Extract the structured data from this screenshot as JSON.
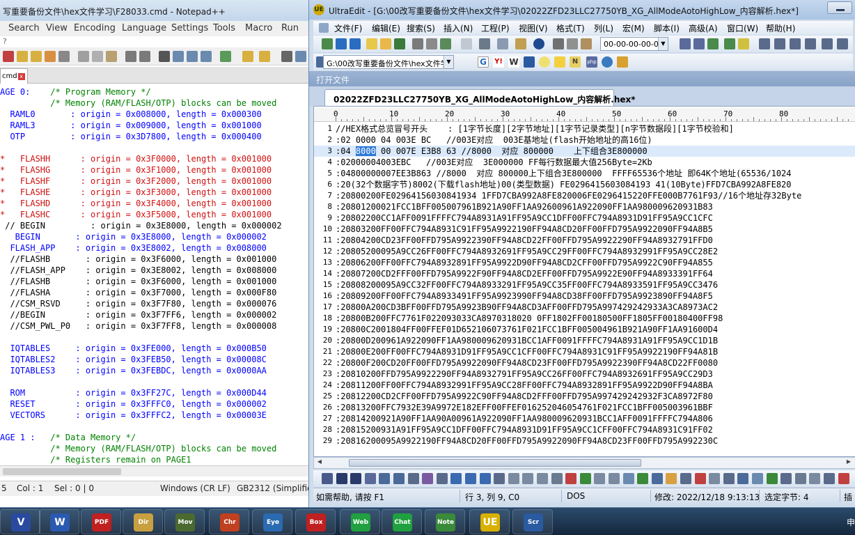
{
  "npp": {
    "title": "写重要备份文件\\hex文件学习\\F28033.cmd - Notepad++",
    "menu": [
      "Search",
      "View",
      "Encoding",
      "Language",
      "Settings",
      "Tools",
      "Macro",
      "Run"
    ],
    "menu_extra": "?",
    "tab_label": "cmd",
    "tab_close": "x",
    "code_lines": [
      {
        "a": "AGE 0:    ",
        "b": "/* Program Memory */",
        "cls": "c-kw"
      },
      {
        "a": "          ",
        "b": "/* Memory (RAM/FLASH/OTP) blocks can be moved",
        "cls": "c-kw"
      },
      {
        "a": "  RAML0       : origin = 0x008000, length = 0x000300",
        "b": "",
        "cls": ""
      },
      {
        "a": "  RAML3       : origin = 0x009000, length = 0x001000",
        "b": "",
        "cls": ""
      },
      {
        "a": "  OTP         : origin = 0x3D7800, length = 0x000400",
        "b": "",
        "cls": ""
      },
      {
        "a": "",
        "b": "",
        "cls": ""
      },
      {
        "a": "*   FLASHH      : origin = 0x3F0000, length = 0x001000",
        "b": "",
        "cls": ""
      },
      {
        "a": "*   FLASHG      : origin = 0x3F1000, length = 0x001000",
        "b": "",
        "cls": ""
      },
      {
        "a": "*   FLASHF      : origin = 0x3F2000, length = 0x001000",
        "b": "",
        "cls": ""
      },
      {
        "a": "*   FLASHE      : origin = 0x3F3000, length = 0x001000",
        "b": "",
        "cls": ""
      },
      {
        "a": "*   FLASHD      : origin = 0x3F4000, length = 0x001000",
        "b": "",
        "cls": ""
      },
      {
        "a": "*   FLASHC      : origin = 0x3F5000, length = 0x001000",
        "b": "",
        "cls": ""
      },
      {
        "a": " // BEGIN         : origin = 0x3E8000, length = 0x000002",
        "b": "",
        "cls": ""
      },
      {
        "a": "   BEGIN       : origin = 0x3E8000, length = 0x000002",
        "b": "",
        "cls": ""
      },
      {
        "a": "  FLASH_APP    : origin = 0x3E8002, length = 0x008000",
        "b": "",
        "cls": ""
      },
      {
        "a": "  //FLASHB       : origin = 0x3F6000, length = 0x001000",
        "b": "",
        "cls": ""
      },
      {
        "a": "  //FLASH_APP    : origin = 0x3E8002, length = 0x008000",
        "b": "",
        "cls": ""
      },
      {
        "a": "  //FLASHB       : origin = 0x3F6000, length = 0x001000",
        "b": "",
        "cls": ""
      },
      {
        "a": "  //FLASHA       : origin = 0x3F7000, length = 0x000F80",
        "b": "",
        "cls": ""
      },
      {
        "a": "  //CSM_RSVD     : origin = 0x3F7F80, length = 0x000076",
        "b": "",
        "cls": ""
      },
      {
        "a": "  //BEGIN        : origin = 0x3F7FF6, length = 0x000002",
        "b": "",
        "cls": ""
      },
      {
        "a": "  //CSM_PWL_P0   : origin = 0x3F7FF8, length = 0x000008",
        "b": "",
        "cls": ""
      },
      {
        "a": "",
        "b": "",
        "cls": ""
      },
      {
        "a": "  IQTABLES     : origin = 0x3FE000, length = 0x000B50",
        "b": "",
        "cls": ""
      },
      {
        "a": "  IQTABLES2    : origin = 0x3FEB50, length = 0x00008C",
        "b": "",
        "cls": ""
      },
      {
        "a": "  IQTABLES3    : origin = 0x3FEBDC, length = 0x0000AA",
        "b": "",
        "cls": ""
      },
      {
        "a": "",
        "b": "",
        "cls": ""
      },
      {
        "a": "  ROM          : origin = 0x3FF27C, length = 0x000D44",
        "b": "",
        "cls": ""
      },
      {
        "a": "  RESET        : origin = 0x3FFFC0, length = 0x000002",
        "b": "",
        "cls": ""
      },
      {
        "a": "  VECTORS      : origin = 0x3FFFC2, length = 0x00003E",
        "b": "",
        "cls": ""
      },
      {
        "a": "",
        "b": "",
        "cls": ""
      },
      {
        "a": "AGE 1 :   ",
        "b": "/* Data Memory */",
        "cls": "c-kw"
      },
      {
        "a": "          ",
        "b": "/* Memory (RAM/FLASH/OTP) blocks can be moved",
        "cls": "c-kw"
      },
      {
        "a": "          ",
        "b": "/* Registers remain on PAGE1",
        "cls": "c-kw"
      }
    ],
    "status": {
      "line": "5",
      "col": "Col : 1",
      "sel": "Sel : 0 | 0",
      "eol": "Windows (CR LF)",
      "enc": "GB2312 (Simplifie"
    }
  },
  "ue": {
    "title": "UltraEdit - [G:\\00改写重要备份文件\\hex文件学习\\02022ZFD23LLC27750YB_XG_AllModeAotoHighLow_内容解析.hex*]",
    "logo": "UE",
    "menu": [
      "文件(F)",
      "编辑(E)",
      "搜索(S)",
      "插入(N)",
      "工程(P)",
      "视图(V)",
      "格式(T)",
      "列(L)",
      "宏(M)",
      "脚本(I)",
      "高级(A)",
      "窗口(W)",
      "帮助(H)"
    ],
    "hex_combo": "00-00-00-00-0(",
    "path_combo": "G:\\00改写重要备份文件\\hex文件学",
    "open_files_label": "打开文件",
    "tab_name": "02022ZFD23LLC27750YB_XG_AllModeAotoHighLow_内容解析.hex*",
    "tab_close": "×",
    "ruler_labels": [
      "0",
      "10",
      "20",
      "30",
      "40",
      "50",
      "60",
      "70",
      "80"
    ],
    "lines": [
      {
        "n": "1",
        "t": "//HEX格式总览冒号开头    : [1字节长度][2字节地址][1字节记录类型][n字节数据段][1字节校验和]"
      },
      {
        "n": "2",
        "t": ":02 0000 04 003E BC   //003E对应  003E基地址(flash开始地址的高16位)"
      },
      {
        "n": "3",
        "pre": ":04 ",
        "hl": "8000",
        "post": " 00 007E E3B8 63 //8000  对应 800000    上下组合3E800000"
      },
      {
        "n": "4",
        "t": ":02000004003EBC   //003E对应  3E000000 FF每行数据最大值256Byte=2Kb"
      },
      {
        "n": "5",
        "t": ":04800000007EE3B863 //8000  对应 800000上下组合3E800000  FFFF65536个地址 即64K个地址(65536/1024"
      },
      {
        "n": "6",
        "t": ":20(32个数据字节)8002(下载flash地址)00(类型数据) FE0296415603084193 41(10Byte)FFD7CBA992A8FE820"
      },
      {
        "n": "7",
        "t": ":20800200FE02964156030841934 1FFD7CBA992A8FE820006FE0296415220FFE000B7761F93//16个地址存32Byte"
      },
      {
        "n": "8",
        "t": ":20801200021FCC1BFF005007961B921A90FF1AA92600961A922090FF1AA980009620931B83"
      },
      {
        "n": "9",
        "t": ":20802200CC1AFF0091FFFFC794A8931A91FF95A9CC1DFF00FFC794A8931D91FF95A9CC1CFC"
      },
      {
        "n": "10",
        "t": ":20803200FF00FFC794A8931C91FF95A9922190FF94A8CD20FF00FFD795A9922090FF94A8B5"
      },
      {
        "n": "11",
        "t": ":20804200CD23FF00FFD795A9922390FF94A8CD22FF00FFD795A9922290FF94A8932791FFD0"
      },
      {
        "n": "12",
        "t": ":20805200095A9CC26FF00FFC794A8932691FF95A9CC29FF00FFC794A8932991FF95A9CC28E2"
      },
      {
        "n": "13",
        "t": ":20806200FF00FFC794A8932891FF95A9922D90FF94A8CD2CFF00FFD795A9922C90FF94A855"
      },
      {
        "n": "14",
        "t": ":20807200CD2FFF00FFD795A9922F90FF94A8CD2EFF00FFD795A9922E90FF94A8933391FF64"
      },
      {
        "n": "15",
        "t": ":20808200095A9CC32FF00FFC794A8933291FF95A9CC35FF00FFC794A8933591FF95A9CC3476"
      },
      {
        "n": "16",
        "t": ":20809200FF00FFC794A8933491FF95A9923990FF94A8CD38FF00FFD795A9923890FF94A8F5"
      },
      {
        "n": "17",
        "t": ":20800A200CD3BFF00FFD795A9923B90FF94A8CD3AFF00FFD795A997429242933A3CA8973AC2"
      },
      {
        "n": "18",
        "t": ":20800B200FFC7761F022093033CA8970318020 0FF1802FF00180500FF1805FF00180400FF98"
      },
      {
        "n": "19",
        "t": ":20800C2001804FF00FFEF01D652106073761F021FCC1BFF005004961B921A90FF1AA91600D4"
      },
      {
        "n": "20",
        "t": ":20800D200961A922090FF1AA980009620931BCC1AFF0091FFFFC794A8931A91FF95A9CC1D1B"
      },
      {
        "n": "21",
        "t": ":20800E200FF00FFC794A8931D91FF95A9CC1CFF00FFC794A8931C91FF95A9922190FF94A81B"
      },
      {
        "n": "22",
        "t": ":20800F200CD20FF00FFD795A9922090FF94A8CD23FF00FFD795A9922390FF94A8CD22FF0080"
      },
      {
        "n": "23",
        "t": ":20810200FFD795A9922290FF94A8932791FF95A9CC26FF00FFC794A8932691FF95A9CC29D3"
      },
      {
        "n": "24",
        "t": ":20811200FF00FFC794A8932991FF95A9CC28FF00FFC794A8932891FF95A9922D90FF94A8BA"
      },
      {
        "n": "25",
        "t": ":20812200CD2CFF00FFD795A9922C90FF94A8CD2FFF00FFD795A997429242932F3CA8972F80"
      },
      {
        "n": "26",
        "t": ":20813200FFC7932E39A9972E182EFF00FFEF016252046054761F021FCC1BFF005003961BBF"
      },
      {
        "n": "27",
        "t": ":20814200921A90FF1AA90A00961A922090FF1AA980009620931BCC1AFF0091FFFFC794A806"
      },
      {
        "n": "28",
        "t": ":20815200931A91FF95A9CC1DFF00FFC794A8931D91FF95A9CC1CFF00FFC794A8931C91FF02"
      },
      {
        "n": "29",
        "t": ":20816200095A9922190FF94A8CD20FF00FFD795A9922090FF94A8CD23FF00FFD795A992230C"
      }
    ],
    "status": {
      "help": "如需帮助, 请按 F1",
      "pos": "行 3, 列 9, C0",
      "format": "DOS",
      "modified": "修改: 2022/12/18 9:13:13",
      "selected": "选定字节: 4",
      "ins": "插"
    }
  },
  "taskbar": {
    "apps": [
      "V",
      "W",
      "PDF",
      "Dir",
      "Mov",
      "Chr",
      "Eye",
      "Box",
      "Web",
      "Chat",
      "Note",
      "UE",
      "Scr"
    ],
    "tray_text": "申"
  }
}
